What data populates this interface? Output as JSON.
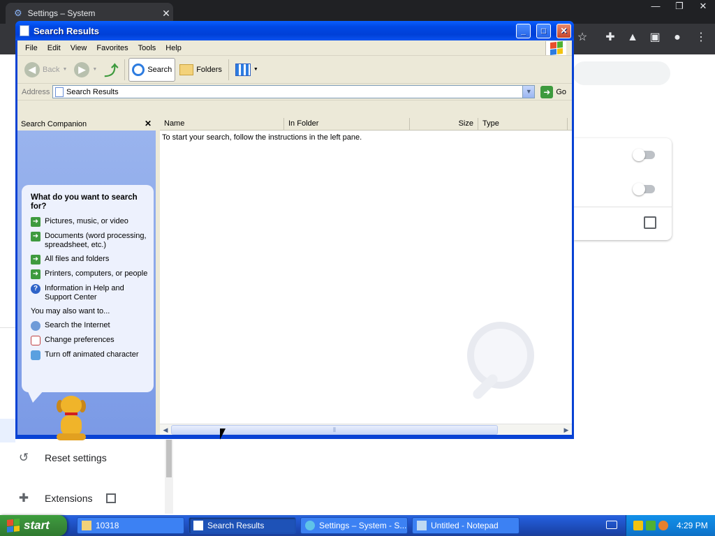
{
  "chrome": {
    "tab_title": "Settings – System",
    "tab_close": "✕",
    "window_controls": [
      "—",
      "❐",
      "✕"
    ],
    "toolbar_icons": [
      "star-icon",
      "puzzle-icon",
      "flask-icon",
      "sidepanel-icon",
      "profile-icon",
      "menu-icon"
    ],
    "sidebar": {
      "items": [
        {
          "label": "Reset settings",
          "icon": "history-icon"
        },
        {
          "label": "Extensions",
          "icon": "puzzle-icon"
        }
      ]
    }
  },
  "window": {
    "title": "Search Results",
    "buttons": [
      "_",
      "□",
      "✕"
    ],
    "menus": [
      "File",
      "Edit",
      "View",
      "Favorites",
      "Tools",
      "Help"
    ],
    "toolbar": {
      "back": "Back",
      "search": "Search",
      "folders": "Folders"
    },
    "address": {
      "label": "Address",
      "value": "Search Results",
      "go": "Go"
    },
    "companion": {
      "header": "Search Companion",
      "close": "✕",
      "heading": "What do you want to search for?",
      "options": [
        "Pictures, music, or video",
        "Documents (word processing, spreadsheet, etc.)",
        "All files and folders",
        "Printers, computers, or people",
        "Information in Help and Support Center"
      ],
      "also_label": "You may also want to...",
      "also_options": [
        "Search the Internet",
        "Change preferences",
        "Turn off animated character"
      ]
    },
    "results": {
      "columns": [
        "Name",
        "In Folder",
        "Size",
        "Type",
        "D"
      ],
      "message": "To start your search, follow the instructions in the left pane."
    }
  },
  "taskbar": {
    "start": "start",
    "tasks": [
      {
        "label": "10318",
        "active": false
      },
      {
        "label": "Search Results",
        "active": true
      },
      {
        "label": "Settings – System - S...",
        "active": false
      },
      {
        "label": "Untitled - Notepad",
        "active": false
      }
    ],
    "clock": "4:29 PM"
  },
  "colors": {
    "xp_blue": "#0842d4",
    "start_green": "#3a8d3a",
    "companion_blue": "#7b9ae6"
  }
}
